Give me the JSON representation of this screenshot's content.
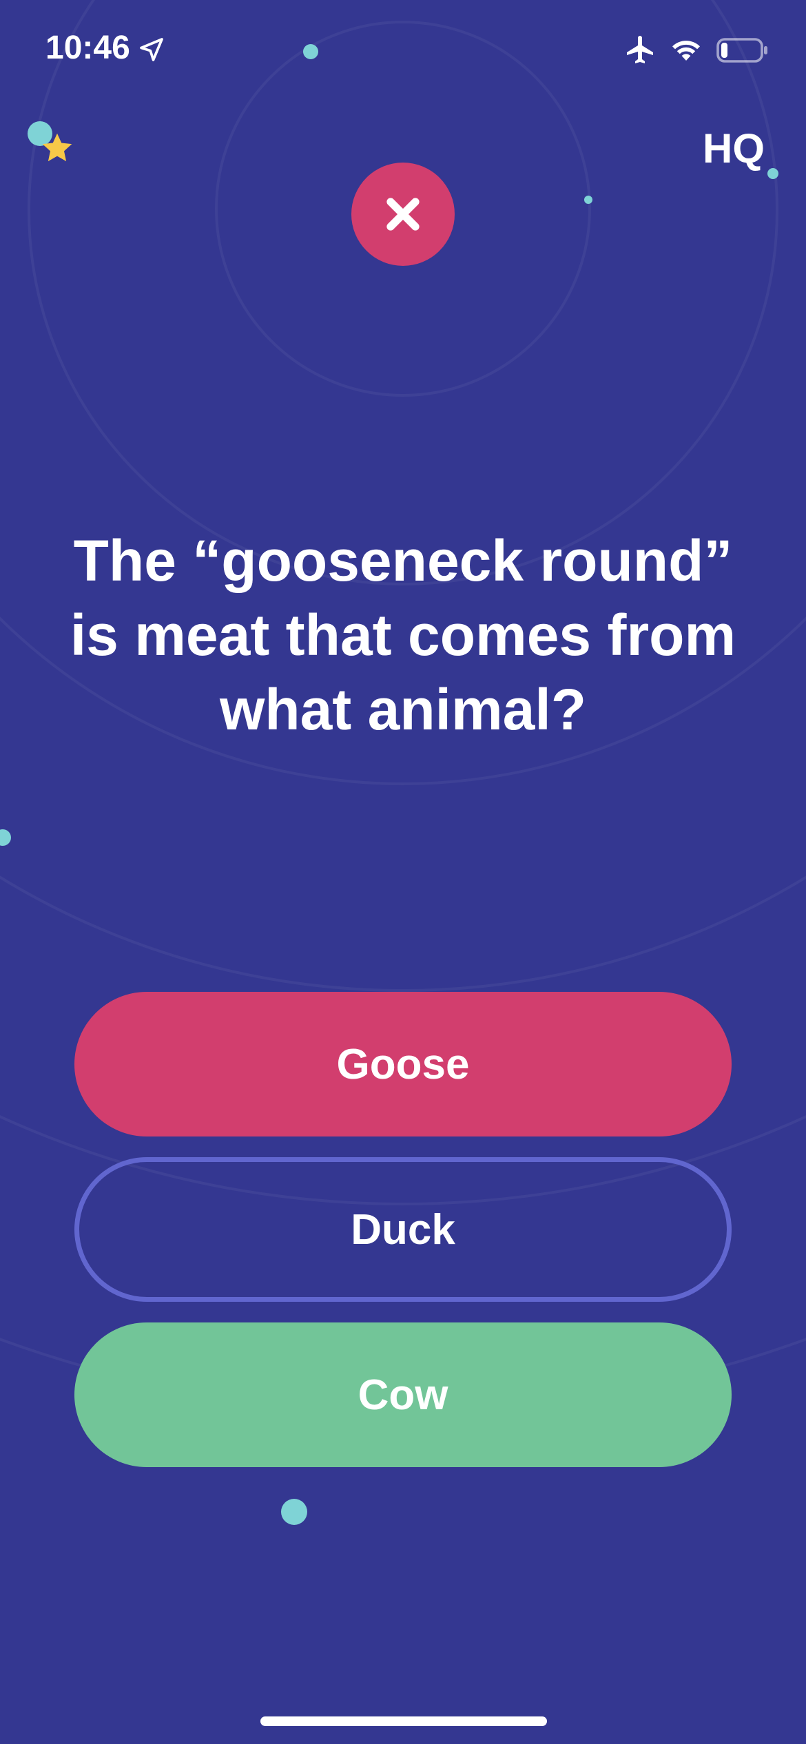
{
  "status_bar": {
    "time": "10:46",
    "icons": [
      "location-arrow-icon",
      "airplane-icon",
      "wifi-icon",
      "battery-icon"
    ]
  },
  "header": {
    "logo_text": "HQ",
    "star_icon": "star-icon",
    "result_icon": "x-icon"
  },
  "question": {
    "text": "The “gooseneck round” is meat that comes from what animal?"
  },
  "answers": [
    {
      "label": "Goose",
      "state": "selected-wrong",
      "color": "#d23e6e"
    },
    {
      "label": "Duck",
      "state": "unselected",
      "color": "#6166cf"
    },
    {
      "label": "Cow",
      "state": "correct",
      "color": "#72c598"
    }
  ],
  "colors": {
    "background": "#343791",
    "wrong": "#d23e6e",
    "correct": "#72c598",
    "outline": "#6166cf",
    "dot": "#7fd3d6",
    "star": "#f7c948"
  }
}
